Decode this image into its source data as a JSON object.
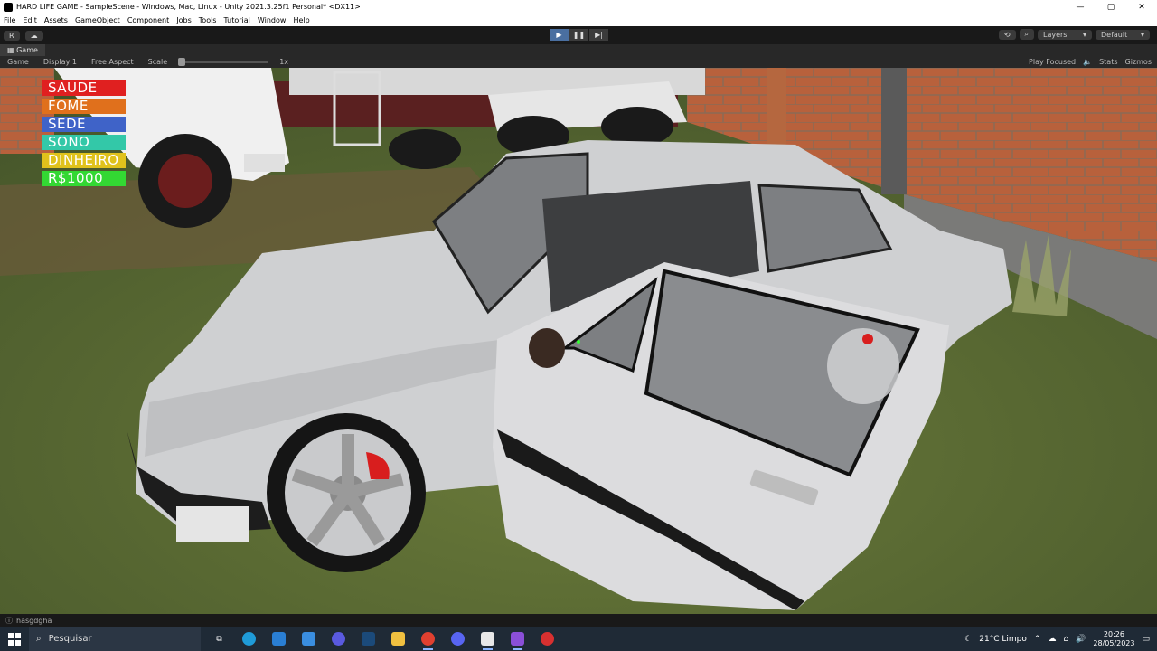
{
  "window": {
    "title": "HARD LIFE GAME - SampleScene - Windows, Mac, Linux - Unity 2021.3.25f1 Personal* <DX11>",
    "min": "—",
    "max": "▢",
    "close": "✕"
  },
  "menu": [
    "File",
    "Edit",
    "Assets",
    "GameObject",
    "Component",
    "Jobs",
    "Tools",
    "Tutorial",
    "Window",
    "Help"
  ],
  "toolbar": {
    "account": "R",
    "cloud": "☁",
    "play": "▶",
    "pause": "❚❚",
    "step": "▶|",
    "history": "⟲",
    "search": "⌕",
    "layers": "Layers",
    "layout": "Default"
  },
  "tab": {
    "label": "Game"
  },
  "gamebar": {
    "mode": "Game",
    "display": "Display 1",
    "aspect": "Free Aspect",
    "scale_label": "Scale",
    "scale_value": "1x",
    "play_focused": "Play Focused",
    "stats": "Stats",
    "gizmos": "Gizmos"
  },
  "hud": [
    {
      "label": "SAUDE",
      "color": "#e02020"
    },
    {
      "label": "FOME",
      "color": "#e0701c"
    },
    {
      "label": "SEDE",
      "color": "#3f63c8"
    },
    {
      "label": "SONO",
      "color": "#33c8a8"
    },
    {
      "label": "DINHEIRO",
      "color": "#e0c21c"
    },
    {
      "label": "R$1000",
      "color": "#33d833"
    }
  ],
  "status": {
    "text": "hasgdgha"
  },
  "taskbar": {
    "search_placeholder": "Pesquisar",
    "weather": "21°C  Limpo",
    "time": "20:26",
    "date": "28/05/2023"
  }
}
